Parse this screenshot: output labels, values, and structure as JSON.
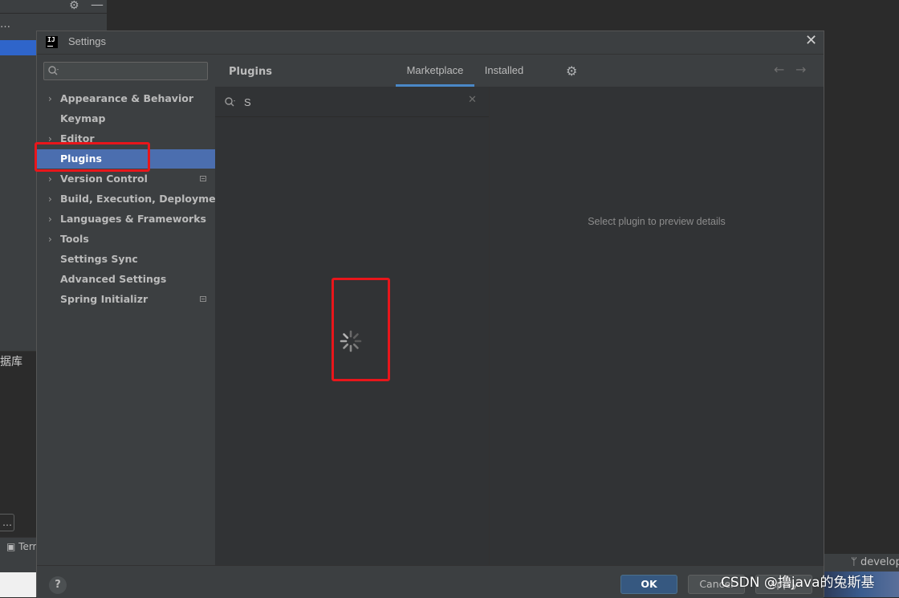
{
  "background_ide": {
    "fragment_text": "…",
    "cjk_fragment": "据库",
    "button_fragment": "…",
    "terminal_tab": "Terminal",
    "branch_label": "develop"
  },
  "dialog": {
    "title": "Settings",
    "app_logo_text": "IJ"
  },
  "sidebar": {
    "search_placeholder": "",
    "items": [
      {
        "label": "Appearance & Behavior",
        "expandable": true,
        "selected": false,
        "badge": false
      },
      {
        "label": "Keymap",
        "expandable": false,
        "selected": false,
        "badge": false
      },
      {
        "label": "Editor",
        "expandable": true,
        "selected": false,
        "badge": false
      },
      {
        "label": "Plugins",
        "expandable": false,
        "selected": true,
        "badge": false
      },
      {
        "label": "Version Control",
        "expandable": true,
        "selected": false,
        "badge": true
      },
      {
        "label": "Build, Execution, Deployment",
        "expandable": true,
        "selected": false,
        "badge": false
      },
      {
        "label": "Languages & Frameworks",
        "expandable": true,
        "selected": false,
        "badge": false
      },
      {
        "label": "Tools",
        "expandable": true,
        "selected": false,
        "badge": false
      },
      {
        "label": "Settings Sync",
        "expandable": false,
        "selected": false,
        "badge": false
      },
      {
        "label": "Advanced Settings",
        "expandable": false,
        "selected": false,
        "badge": false
      },
      {
        "label": "Spring Initializr",
        "expandable": false,
        "selected": false,
        "badge": true
      }
    ]
  },
  "main": {
    "heading": "Plugins",
    "tabs": [
      {
        "label": "Marketplace",
        "active": true
      },
      {
        "label": "Installed",
        "active": false
      }
    ],
    "search_value": "S",
    "detail_placeholder": "Select plugin to preview details"
  },
  "footer": {
    "help_label": "?",
    "ok_label": "OK",
    "cancel_label": "Cancel",
    "apply_label": "Apply"
  },
  "watermark": "CSDN @撸java的兔斯基",
  "colors": {
    "accent_selected": "#4b6eaf",
    "tab_underline": "#4a88c7",
    "annotation_red": "#e8161b",
    "ok_button": "#365880"
  }
}
